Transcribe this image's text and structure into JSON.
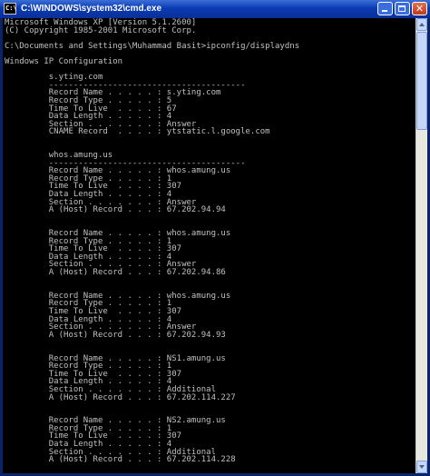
{
  "window": {
    "title": "C:\\WINDOWS\\system32\\cmd.exe",
    "icon_label": "C:\\",
    "buttons": [
      "minimize-icon",
      "maximize-icon",
      "close-icon"
    ],
    "close_glyph": "✕"
  },
  "console": {
    "text_color": "#c0c0c0",
    "background": "#000000",
    "lines": [
      "Microsoft Windows XP [Version 5.1.2600]",
      "(C) Copyright 1985-2001 Microsoft Corp.",
      "",
      "C:\\Documents and Settings\\Muhammad Basit>ipconfig/displaydns",
      "",
      "Windows IP Configuration",
      "",
      "         s.yting.com",
      "         ----------------------------------------",
      "         Record Name . . . . . : s.yting.com",
      "         Record Type . . . . . : 5",
      "         Time To Live  . . . . : 67",
      "         Data Length . . . . . : 4",
      "         Section . . . . . . . : Answer",
      "         CNAME Record  . . . . : ytstatic.l.google.com",
      "",
      "",
      "         whos.amung.us",
      "         ----------------------------------------",
      "         Record Name . . . . . : whos.amung.us",
      "         Record Type . . . . . : 1",
      "         Time To Live  . . . . : 307",
      "         Data Length . . . . . : 4",
      "         Section . . . . . . . : Answer",
      "         A (Host) Record . . . : 67.202.94.94",
      "",
      "",
      "         Record Name . . . . . : whos.amung.us",
      "         Record Type . . . . . : 1",
      "         Time To Live  . . . . : 307",
      "         Data Length . . . . . : 4",
      "         Section . . . . . . . : Answer",
      "         A (Host) Record . . . : 67.202.94.86",
      "",
      "",
      "         Record Name . . . . . : whos.amung.us",
      "         Record Type . . . . . : 1",
      "         Time To Live  . . . . : 307",
      "         Data Length . . . . . : 4",
      "         Section . . . . . . . : Answer",
      "         A (Host) Record . . . : 67.202.94.93",
      "",
      "",
      "         Record Name . . . . . : NS1.amung.us",
      "         Record Type . . . . . : 1",
      "         Time To Live  . . . . : 307",
      "         Data Length . . . . . : 4",
      "         Section . . . . . . . : Additional",
      "         A (Host) Record . . . : 67.202.114.227",
      "",
      "",
      "         Record Name . . . . . : NS2.amung.us",
      "         Record Type . . . . . : 1",
      "         Time To Live  . . . . : 307",
      "         Data Length . . . . . : 4",
      "         Section . . . . . . . : Additional",
      "         A (Host) Record . . . : 67.202.114.228"
    ]
  },
  "scrollbar": {
    "position_fraction": 0,
    "visible_fraction": 0.23
  }
}
